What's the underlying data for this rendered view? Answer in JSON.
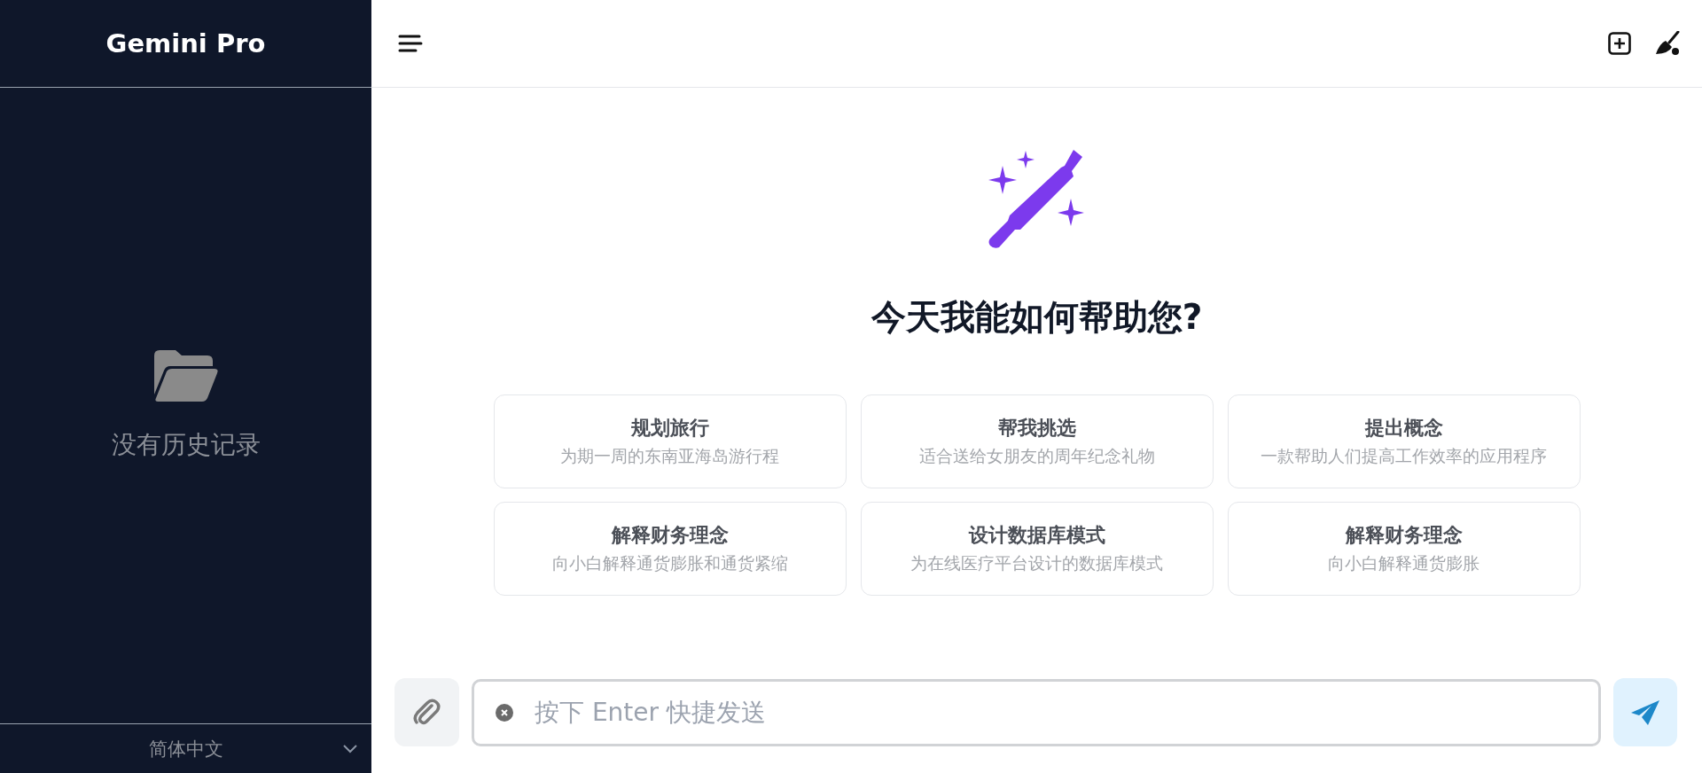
{
  "sidebar": {
    "title": "Gemini Pro",
    "empty_text": "没有历史记录",
    "language": "简体中文"
  },
  "main": {
    "heading": "今天我能如何帮助您?",
    "suggestions": [
      {
        "title": "规划旅行",
        "subtitle": "为期一周的东南亚海岛游行程"
      },
      {
        "title": "帮我挑选",
        "subtitle": "适合送给女朋友的周年纪念礼物"
      },
      {
        "title": "提出概念",
        "subtitle": "一款帮助人们提高工作效率的应用程序"
      },
      {
        "title": "解释财务理念",
        "subtitle": "向小白解释通货膨胀和通货紧缩"
      },
      {
        "title": "设计数据库模式",
        "subtitle": "为在线医疗平台设计的数据库模式"
      },
      {
        "title": "解释财务理念",
        "subtitle": "向小白解释通货膨胀"
      }
    ]
  },
  "input": {
    "placeholder": "按下 Enter 快捷发送"
  }
}
